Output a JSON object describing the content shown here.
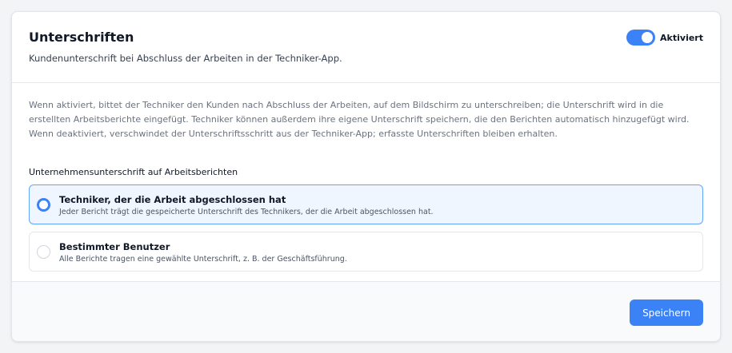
{
  "header": {
    "title": "Unterschriften",
    "subtitle": "Kundenunterschrift bei Abschluss der Arbeiten in der Techniker-App.",
    "toggle": {
      "label": "Aktiviert",
      "checked": true
    }
  },
  "main": {
    "description": "Wenn aktiviert, bittet der Techniker den Kunden nach Abschluss der Arbeiten, auf dem Bildschirm zu unterschreiben; die Unterschrift wird in die erstellten Arbeitsberichte eingefügt. Techniker können außerdem ihre eigene Unterschrift speichern, die den Berichten automatisch hinzugefügt wird. Wenn deaktiviert, verschwindet der Unterschriftsschritt aus der Techniker-App; erfasste Unterschriften bleiben erhalten.",
    "section_label": "Unternehmensunterschrift auf Arbeitsberichten",
    "options": [
      {
        "title": "Techniker, der die Arbeit abgeschlossen hat",
        "description": "Jeder Bericht trägt die gespeicherte Unterschrift des Technikers, der die Arbeit abgeschlossen hat.",
        "selected": true
      },
      {
        "title": "Bestimmter Benutzer",
        "description": "Alle Berichte tragen eine gewählte Unterschrift, z. B. der Geschäftsführung.",
        "selected": false
      }
    ]
  },
  "footer": {
    "save_label": "Speichern"
  },
  "colors": {
    "accent": "#3b82f6",
    "selected_background": "#eff6ff",
    "selected_border": "#60a5fa"
  }
}
